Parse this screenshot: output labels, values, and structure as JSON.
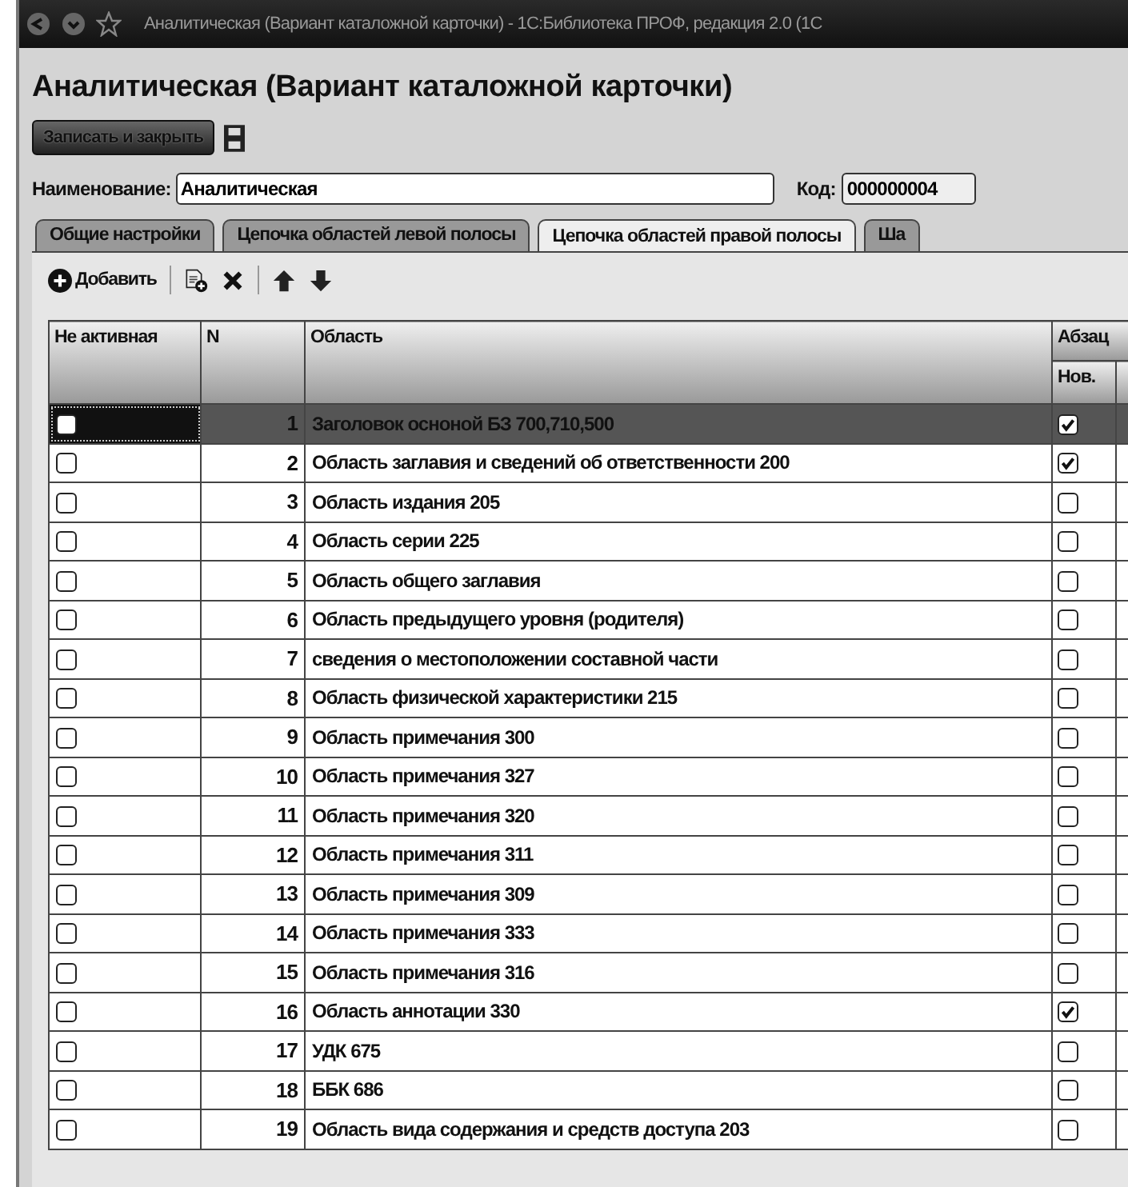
{
  "window": {
    "title": "Аналитическая (Вариант каталожной карточки) - 1С:Библиотека ПРОФ, редакция 2.0 (1С"
  },
  "form": {
    "heading": "Аналитическая (Вариант каталожной карточки)",
    "save_close_button": "Записать и закрыть",
    "name_label": "Наименование:",
    "name_value": "Аналитическая",
    "code_label": "Код:",
    "code_value": "000000004"
  },
  "tabs": [
    {
      "label": "Общие настройки",
      "selected": false
    },
    {
      "label": "Цепочка областей левой полосы",
      "selected": false
    },
    {
      "label": "Цепочка областей правой полосы",
      "selected": true
    },
    {
      "label": "Ша",
      "selected": false
    }
  ],
  "toolbar": {
    "add_button": "Добавить"
  },
  "table": {
    "columns": [
      "Не активная",
      "N",
      "Область",
      "Абзац"
    ],
    "subcolumns": [
      "Нов."
    ],
    "rows": [
      {
        "inactive": false,
        "n": "1",
        "area": "Заголовок осноной БЗ 700,710,500",
        "new": true,
        "selected": true
      },
      {
        "inactive": false,
        "n": "2",
        "area": "Область заглавия  и сведений об ответственности 200",
        "new": true,
        "selected": false
      },
      {
        "inactive": false,
        "n": "3",
        "area": "Область издания 205",
        "new": false,
        "selected": false
      },
      {
        "inactive": false,
        "n": "4",
        "area": "Область серии 225",
        "new": false,
        "selected": false
      },
      {
        "inactive": false,
        "n": "5",
        "area": "Область общего заглавия",
        "new": false,
        "selected": false
      },
      {
        "inactive": false,
        "n": "6",
        "area": "Область предыдущего уровня (родителя)",
        "new": false,
        "selected": false
      },
      {
        "inactive": false,
        "n": "7",
        "area": "сведения о местоположении составной части",
        "new": false,
        "selected": false
      },
      {
        "inactive": false,
        "n": "8",
        "area": "Область физической характеристики 215",
        "new": false,
        "selected": false
      },
      {
        "inactive": false,
        "n": "9",
        "area": "Область примечания 300",
        "new": false,
        "selected": false
      },
      {
        "inactive": false,
        "n": "10",
        "area": "Область примечания 327",
        "new": false,
        "selected": false
      },
      {
        "inactive": false,
        "n": "11",
        "area": "Область примечания 320",
        "new": false,
        "selected": false
      },
      {
        "inactive": false,
        "n": "12",
        "area": "Область примечания 311",
        "new": false,
        "selected": false
      },
      {
        "inactive": false,
        "n": "13",
        "area": "Область примечания 309",
        "new": false,
        "selected": false
      },
      {
        "inactive": false,
        "n": "14",
        "area": "Область примечания 333",
        "new": false,
        "selected": false
      },
      {
        "inactive": false,
        "n": "15",
        "area": "Область примечания 316",
        "new": false,
        "selected": false
      },
      {
        "inactive": false,
        "n": "16",
        "area": "Область аннотации 330",
        "new": true,
        "selected": false
      },
      {
        "inactive": false,
        "n": "17",
        "area": "УДК 675",
        "new": false,
        "selected": false
      },
      {
        "inactive": false,
        "n": "18",
        "area": "ББК 686",
        "new": false,
        "selected": false
      },
      {
        "inactive": false,
        "n": "19",
        "area": "Область вида содержания и средств доступа 203",
        "new": false,
        "selected": false
      }
    ]
  }
}
